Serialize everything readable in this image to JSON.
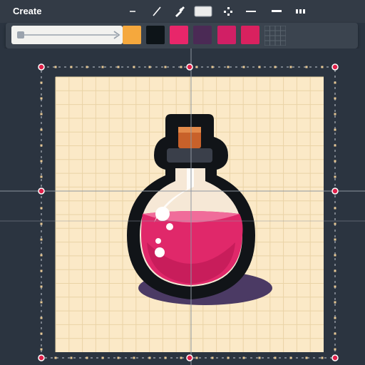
{
  "window": {
    "title": "Create"
  },
  "toolbar": {
    "tools": [
      {
        "name": "line-thin-tool",
        "icon": "minus-icon"
      },
      {
        "name": "line-diagonal-tool",
        "icon": "line-icon"
      },
      {
        "name": "eyedropper-tool",
        "icon": "eyedropper-icon"
      },
      {
        "name": "rectangle-tool",
        "icon": "rectangle-icon"
      },
      {
        "name": "move-tool",
        "icon": "move-icon"
      },
      {
        "name": "stroke-medium-tool",
        "icon": "stroke-medium-icon"
      },
      {
        "name": "stroke-thick-tool",
        "icon": "stroke-thick-icon"
      },
      {
        "name": "more-tool",
        "icon": "grid-dots-icon"
      }
    ]
  },
  "palette": {
    "slider_icon": "arrow-slider-icon",
    "swatches": [
      {
        "name": "orange-swatch",
        "color": "#f5a83d"
      },
      {
        "name": "black-swatch",
        "color": "#0d1418"
      },
      {
        "name": "pink-swatch",
        "color": "#e8266a"
      },
      {
        "name": "purple-swatch",
        "color": "#4b2a55"
      },
      {
        "name": "magenta-swatch",
        "color": "#d11f65"
      },
      {
        "name": "crimson-swatch",
        "color": "#d9215f"
      }
    ],
    "grid_icon": "grid-icon"
  },
  "canvas": {
    "background_color": "#fbe9c7",
    "grid_color": "#ead3a6",
    "potion_liquid_color": "#e0286a",
    "potion_outline_color": "#111418",
    "cork_color": "#c8612a",
    "shadow_color": "#4b3a64"
  }
}
